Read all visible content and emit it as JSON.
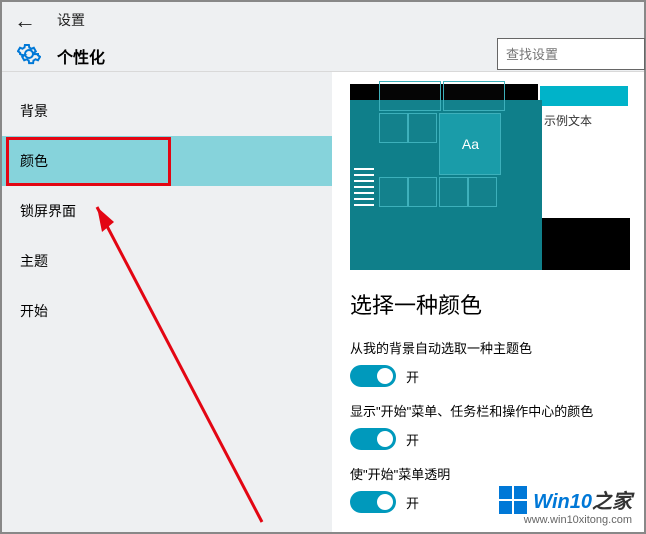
{
  "header": {
    "app_title": "设置",
    "category": "个性化",
    "search_placeholder": "查找设置"
  },
  "sidebar": {
    "items": [
      {
        "label": "背景",
        "active": false
      },
      {
        "label": "颜色",
        "active": true
      },
      {
        "label": "锁屏界面",
        "active": false
      },
      {
        "label": "主题",
        "active": false
      },
      {
        "label": "开始",
        "active": false
      }
    ]
  },
  "preview": {
    "sample_text": "示例文本",
    "tile_label": "Aa"
  },
  "content": {
    "section_title": "选择一种颜色",
    "options": [
      {
        "label": "从我的背景自动选取一种主题色",
        "state": "开"
      },
      {
        "label": "显示\"开始\"菜单、任务栏和操作中心的颜色",
        "state": "开"
      },
      {
        "label": "使\"开始\"菜单透明",
        "state": "开"
      }
    ]
  },
  "watermark": {
    "brand": "Win10之家",
    "url": "www.win10xitong.com"
  }
}
